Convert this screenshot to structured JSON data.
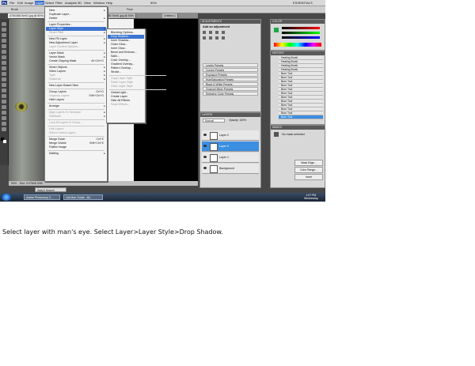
{
  "menubar": {
    "app_icon": "Ps",
    "items": [
      "File",
      "Edit",
      "Image",
      "Layer",
      "Select",
      "Filter",
      "Analysis",
      "3D",
      "View",
      "Window",
      "Help"
    ],
    "active_item": "Layer",
    "zoom": "50%",
    "workspace": "ESSENTIALS"
  },
  "options": {
    "tool": "Brush",
    "mode": "Mode:",
    "opacity": "Opacity:",
    "flow": "Flow:"
  },
  "tabs": [
    "475X368 Sm01 jpg @ 50% (Layer 0, RGB/8)",
    "4701080 Sm01 jpg @ 50%",
    "Untitled-1"
  ],
  "layer_menu": {
    "items": [
      {
        "label": "New",
        "arrow": true
      },
      {
        "label": "Duplicate Layer..."
      },
      {
        "label": "Delete",
        "arrow": true
      },
      {
        "sep": true
      },
      {
        "label": "Layer Properties..."
      },
      {
        "label": "Layer Style",
        "arrow": true,
        "highlight": true
      },
      {
        "label": "Smart Filter",
        "arrow": true,
        "disabled": true
      },
      {
        "sep": true
      },
      {
        "label": "New Fill Layer",
        "arrow": true
      },
      {
        "label": "New Adjustment Layer",
        "arrow": true
      },
      {
        "label": "Layer Content Options...",
        "disabled": true
      },
      {
        "sep": true
      },
      {
        "label": "Layer Mask",
        "arrow": true
      },
      {
        "label": "Vector Mask",
        "arrow": true
      },
      {
        "label": "Create Clipping Mask",
        "shortcut": "Alt+Ctrl+G"
      },
      {
        "sep": true
      },
      {
        "label": "Smart Objects",
        "arrow": true
      },
      {
        "label": "Video Layers",
        "arrow": true
      },
      {
        "label": "Type",
        "arrow": true,
        "disabled": true
      },
      {
        "label": "Rasterize",
        "arrow": true,
        "disabled": true
      },
      {
        "sep": true
      },
      {
        "label": "New Layer Based Slice"
      },
      {
        "sep": true
      },
      {
        "label": "Group Layers",
        "shortcut": "Ctrl+G"
      },
      {
        "label": "Ungroup Layers",
        "shortcut": "Shift+Ctrl+G",
        "disabled": true
      },
      {
        "label": "Hide Layers"
      },
      {
        "sep": true
      },
      {
        "label": "Arrange",
        "arrow": true
      },
      {
        "sep": true
      },
      {
        "label": "Align Layers To Selection",
        "arrow": true,
        "disabled": true
      },
      {
        "label": "Distribute",
        "arrow": true,
        "disabled": true
      },
      {
        "sep": true
      },
      {
        "label": "Lock All Layers in Group...",
        "disabled": true
      },
      {
        "sep": true
      },
      {
        "label": "Link Layers",
        "disabled": true
      },
      {
        "label": "Select Linked Layers",
        "disabled": true
      },
      {
        "sep": true
      },
      {
        "label": "Merge Down",
        "shortcut": "Ctrl+E"
      },
      {
        "label": "Merge Visible",
        "shortcut": "Shift+Ctrl+E"
      },
      {
        "label": "Flatten Image"
      },
      {
        "sep": true
      },
      {
        "label": "Matting",
        "arrow": true
      }
    ]
  },
  "style_menu": {
    "items": [
      {
        "label": "Blending Options..."
      },
      {
        "label": "Drop Shadow...",
        "highlight": true
      },
      {
        "label": "Inner Shadow..."
      },
      {
        "label": "Outer Glow..."
      },
      {
        "label": "Inner Glow..."
      },
      {
        "label": "Bevel and Emboss..."
      },
      {
        "label": "Satin..."
      },
      {
        "label": "Color Overlay..."
      },
      {
        "label": "Gradient Overlay..."
      },
      {
        "label": "Pattern Overlay..."
      },
      {
        "label": "Stroke..."
      },
      {
        "sep": true
      },
      {
        "label": "Copy Layer Style",
        "disabled": true
      },
      {
        "label": "Paste Layer Style",
        "disabled": true
      },
      {
        "label": "Clear Layer Style",
        "disabled": true
      },
      {
        "sep": true
      },
      {
        "label": "Global Light..."
      },
      {
        "label": "Create Layer"
      },
      {
        "label": "Hide All Effects"
      },
      {
        "label": "Scale Effects...",
        "disabled": true
      }
    ]
  },
  "adjustments": {
    "title": "ADJUSTMENTS",
    "subtitle": "Add an adjustment",
    "presets": [
      "Levels Presets",
      "Curves Presets",
      "Exposure Presets",
      "Hue/Saturation Presets",
      "Black & White Presets",
      "Channel Mixer Presets",
      "Selective Color Presets"
    ]
  },
  "layers": {
    "title": "LAYERS",
    "blend_mode": "Normal",
    "opacity_label": "Opacity: 100%",
    "rows": [
      {
        "name": "Layer 2",
        "selected": false
      },
      {
        "name": "Layer 0",
        "selected": true
      },
      {
        "name": "Layer 1",
        "selected": false
      },
      {
        "name": "Background",
        "selected": false
      }
    ]
  },
  "color_panel": {
    "title": "COLOR"
  },
  "history": {
    "title": "HISTORY",
    "items": [
      "Healing Brush",
      "Healing Brush",
      "Healing Brush",
      "Healing Brush",
      "Burn Tool",
      "Burn Tool",
      "Burn Tool",
      "Burn Tool",
      "Burn Tool",
      "Burn Tool",
      "Burn Tool",
      "Burn Tool",
      "Burn Tool",
      "Burn Tool",
      "Burn Tool",
      "Burn Tool"
    ]
  },
  "masks": {
    "title": "MASKS",
    "label": "No mask selected",
    "buttons": [
      "Mask Edge...",
      "Color Range...",
      "Invert"
    ]
  },
  "status": {
    "zoom": "50%",
    "doc": "Doc: 3.07M/6.33M"
  },
  "taskbar": {
    "search": "Watch Search",
    "buttons": [
      "Adobe Photoshop C...",
      "Cat Man Guide - Mi..."
    ],
    "clock_time": "1:07 PM",
    "clock_day": "Wednesday"
  },
  "caption": "Select layer with man's eye. Select Layer>Layer Style>Drop Shadow."
}
